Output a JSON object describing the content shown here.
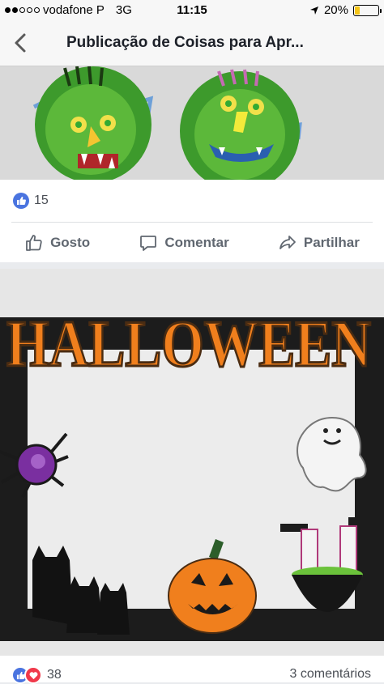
{
  "status": {
    "carrier": "vodafone P",
    "network": "3G",
    "time": "11:15",
    "battery": "20%",
    "battery_level": 0.2
  },
  "nav": {
    "title": "Publicação de Coisas para Apr..."
  },
  "post1": {
    "like_count": "15",
    "actions": {
      "like": "Gosto",
      "comment": "Comentar",
      "share": "Partilhar"
    }
  },
  "post2": {
    "image_text": "HALLOWEEN",
    "reaction_count": "38",
    "comments": "3 comentários"
  },
  "colors": {
    "accent": "#4a74e0",
    "love": "#f0394b",
    "pumpkin": "#f07f1d"
  }
}
